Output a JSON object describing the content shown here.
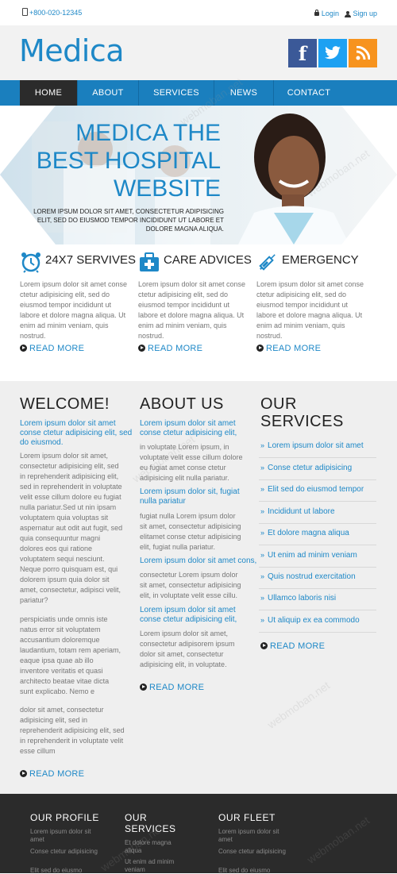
{
  "topbar": {
    "phone": "+800-020-12345",
    "login": "Login",
    "signup": "Sign up"
  },
  "header": {
    "logo": "Medica",
    "social": {
      "facebook": "f"
    }
  },
  "nav": {
    "items": [
      "HOME",
      "ABOUT",
      "SERVICES",
      "NEWS",
      "CONTACT"
    ],
    "active": "HOME"
  },
  "banner": {
    "title_line1": "MEDICA THE",
    "title_line2": "BEST HOSPITAL",
    "title_line3": "WEBSITE",
    "subtitle": "LOREM IPSUM DOLOR SIT AMET, CONSECTETUR ADIPISICING ELIT, SED DO EIUSMOD TEMPOR INCIDIDUNT UT LABORE ET DOLORE MAGNA ALIQUA."
  },
  "features": [
    {
      "title": "24X7 SERVIVES",
      "icon": "alarm-clock-icon",
      "text": "Lorem ipsum dolor sit amet conse ctetur adipisicing elit, sed do eiusmod tempor incididunt ut labore et dolore magna aliqua. Ut enim ad minim veniam, quis nostrud.",
      "read_more": "READ MORE"
    },
    {
      "title": "CARE ADVICES",
      "icon": "medical-kit-icon",
      "text": "Lorem ipsum dolor sit amet conse ctetur adipisicing elit, sed do eiusmod tempor incididunt ut labore et dolore magna aliqua. Ut enim ad minim veniam, quis nostrud.",
      "read_more": "READ MORE"
    },
    {
      "title": "EMERGENCY",
      "icon": "syringe-icon",
      "text": "Lorem ipsum dolor sit amet conse ctetur adipisicing elit, sed do eiusmod tempor incididunt ut labore et dolore magna aliqua. Ut enim ad minim veniam, quis nostrud.",
      "read_more": "READ MORE"
    }
  ],
  "welcome": {
    "title": "WELCOME!",
    "lead": "Lorem ipsum dolor sit amet conse ctetur adipisicing elit, sed do eiusmod.",
    "text1": "Lorem ipsum dolor sit amet, consectetur adipisicing elit, sed in reprehenderit adipisicing elit, sed in reprehenderit in voluptate velit esse cillum dolore eu fugiat nulla pariatur.Sed ut nin ipsam voluptatem quia voluptas sit aspernatur aut odit aut fugit, sed quia consequuntur magni dolores eos qui ratione voluptatem sequi nesciunt. Neque porro quisquam est, qui dolorem ipsum quia dolor sit amet, consectetur, adipisci velit, pariatur?",
    "text2": "perspiciatis unde omnis iste natus error sit voluptatem accusantium doloremque laudantium, totam rem aperiam, eaque ipsa quae ab illo inventore veritatis et quasi architecto beatae vitae dicta sunt explicabo. Nemo e",
    "text3": "dolor sit amet, consectetur adipisicing elit, sed in reprehenderit adipisicing elit, sed in reprehenderit in voluptate velit esse cillum",
    "read_more": "READ MORE"
  },
  "about": {
    "title": "ABOUT US",
    "blocks": [
      {
        "lead": "Lorem ipsum dolor sit amet conse ctetur adipisicing elit,",
        "text": "in voluptate Lorem ipsum, in voluptate velit esse cillum dolore eu fugiat amet conse ctetur adipisicing elit nulla pariatur."
      },
      {
        "lead": "Lorem ipsum dolor sit, fugiat nulla pariatur",
        "text": "fugiat nulla Lorem ipsum dolor sit amet, consectetur adipisicing elitamet conse ctetur adipisicing elit, fugiat nulla pariatur."
      },
      {
        "lead": "Lorem ipsum dolor sit amet cons,",
        "text": "consectetur Lorem ipsum dolor sit amet, consectetur adipisicing elit, in voluptate velit esse cillu."
      },
      {
        "lead": "Lorem ipsum dolor sit amet conse ctetur adipisicing elit,",
        "text": "Lorem ipsum dolor sit amet, consectetur adipisorem ipsum dolor sit amet, consectetur adipisicing elit, in voluptate."
      }
    ],
    "read_more": "READ MORE"
  },
  "services": {
    "title_line1": "OUR",
    "title_line2": "SERVICES",
    "items": [
      "Lorem ipsum dolor sit amet",
      "Conse ctetur adipisicing",
      "Elit sed do eiusmod tempor",
      "Incididunt ut labore",
      "Et dolore magna aliqua",
      "Ut enim ad minim veniam",
      "Quis nostrud exercitation",
      "Ullamco laboris nisi",
      "Ut aliquip ex ea commodo"
    ],
    "read_more": "READ MORE"
  },
  "footer": {
    "profile": {
      "title": "OUR PROFILE",
      "lines": [
        "Lorem ipsum dolor sit amet",
        "Conse ctetur adipisicing",
        "Elit sed do eiusmo"
      ]
    },
    "services": {
      "title_line1": "OUR",
      "title_line2": "SERVICES",
      "lines": [
        "Et dolore magna aliqua",
        "Ut enim ad minim veniam"
      ]
    },
    "fleet": {
      "title": "OUR FLEET",
      "lines": [
        "Lorem ipsum dolor sit amet",
        "Conse ctetur adipisicing",
        "Elit sed do eiusmo"
      ]
    }
  },
  "watermark": "webmoban.net",
  "colors": {
    "accent": "#1e88c7",
    "nav": "#1a7fbe",
    "nav_active": "#2b2b2b",
    "facebook": "#3b5998",
    "twitter": "#1da1f2",
    "rss": "#f7931e",
    "footer": "#2b2b2b"
  }
}
